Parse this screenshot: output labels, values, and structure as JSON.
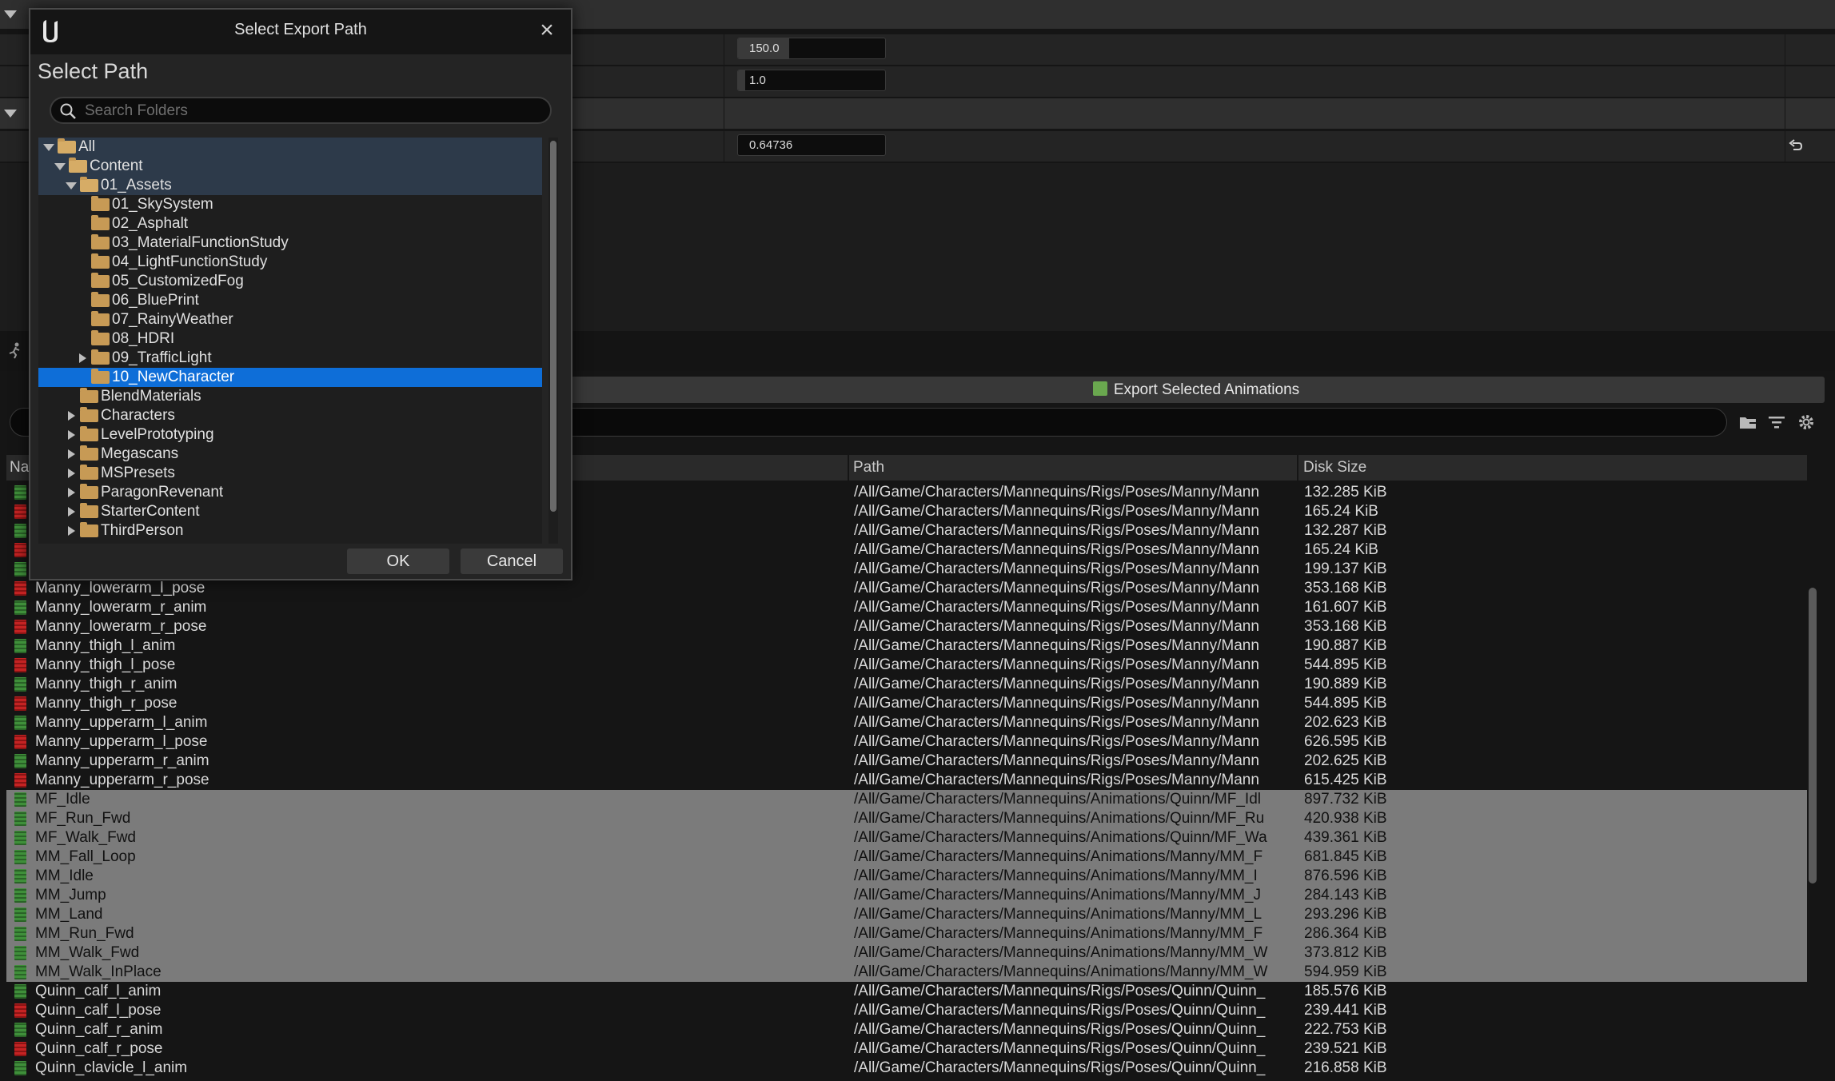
{
  "details": {
    "field_a": "150.0",
    "field_a_fill": 0.35,
    "field_b": "1.0",
    "field_b_fill": 0.05,
    "field_c": "0.64736"
  },
  "export_button": {
    "label": "Export Selected Animations"
  },
  "table": {
    "columns": {
      "name": "Na",
      "path": "Path",
      "size": "Disk Size"
    },
    "rows": [
      {
        "type": "anim",
        "name": "",
        "path": "/All/Game/Characters/Mannequins/Rigs/Poses/Manny/Mann",
        "size": "132.285 KiB",
        "selected": false
      },
      {
        "type": "pose",
        "name": "",
        "path": "/All/Game/Characters/Mannequins/Rigs/Poses/Manny/Mann",
        "size": "165.24 KiB",
        "selected": false
      },
      {
        "type": "anim",
        "name": "",
        "path": "/All/Game/Characters/Mannequins/Rigs/Poses/Manny/Mann",
        "size": "132.287 KiB",
        "selected": false
      },
      {
        "type": "pose",
        "name": "",
        "path": "/All/Game/Characters/Mannequins/Rigs/Poses/Manny/Mann",
        "size": "165.24 KiB",
        "selected": false
      },
      {
        "type": "anim",
        "name": "",
        "path": "/All/Game/Characters/Mannequins/Rigs/Poses/Manny/Mann",
        "size": "199.137 KiB",
        "selected": false
      },
      {
        "type": "pose",
        "name": "Manny_lowerarm_l_pose",
        "path": "/All/Game/Characters/Mannequins/Rigs/Poses/Manny/Mann",
        "size": "353.168 KiB",
        "selected": false
      },
      {
        "type": "anim",
        "name": "Manny_lowerarm_r_anim",
        "path": "/All/Game/Characters/Mannequins/Rigs/Poses/Manny/Mann",
        "size": "161.607 KiB",
        "selected": false
      },
      {
        "type": "pose",
        "name": "Manny_lowerarm_r_pose",
        "path": "/All/Game/Characters/Mannequins/Rigs/Poses/Manny/Mann",
        "size": "353.168 KiB",
        "selected": false
      },
      {
        "type": "anim",
        "name": "Manny_thigh_l_anim",
        "path": "/All/Game/Characters/Mannequins/Rigs/Poses/Manny/Mann",
        "size": "190.887 KiB",
        "selected": false
      },
      {
        "type": "pose",
        "name": "Manny_thigh_l_pose",
        "path": "/All/Game/Characters/Mannequins/Rigs/Poses/Manny/Mann",
        "size": "544.895 KiB",
        "selected": false
      },
      {
        "type": "anim",
        "name": "Manny_thigh_r_anim",
        "path": "/All/Game/Characters/Mannequins/Rigs/Poses/Manny/Mann",
        "size": "190.889 KiB",
        "selected": false
      },
      {
        "type": "pose",
        "name": "Manny_thigh_r_pose",
        "path": "/All/Game/Characters/Mannequins/Rigs/Poses/Manny/Mann",
        "size": "544.895 KiB",
        "selected": false
      },
      {
        "type": "anim",
        "name": "Manny_upperarm_l_anim",
        "path": "/All/Game/Characters/Mannequins/Rigs/Poses/Manny/Mann",
        "size": "202.623 KiB",
        "selected": false
      },
      {
        "type": "pose",
        "name": "Manny_upperarm_l_pose",
        "path": "/All/Game/Characters/Mannequins/Rigs/Poses/Manny/Mann",
        "size": "626.595 KiB",
        "selected": false
      },
      {
        "type": "anim",
        "name": "Manny_upperarm_r_anim",
        "path": "/All/Game/Characters/Mannequins/Rigs/Poses/Manny/Mann",
        "size": "202.625 KiB",
        "selected": false
      },
      {
        "type": "pose",
        "name": "Manny_upperarm_r_pose",
        "path": "/All/Game/Characters/Mannequins/Rigs/Poses/Manny/Mann",
        "size": "615.425 KiB",
        "selected": false
      },
      {
        "type": "anim",
        "name": "MF_Idle",
        "path": "/All/Game/Characters/Mannequins/Animations/Quinn/MF_Idl",
        "size": "897.732 KiB",
        "selected": true
      },
      {
        "type": "anim",
        "name": "MF_Run_Fwd",
        "path": "/All/Game/Characters/Mannequins/Animations/Quinn/MF_Ru",
        "size": "420.938 KiB",
        "selected": true
      },
      {
        "type": "anim",
        "name": "MF_Walk_Fwd",
        "path": "/All/Game/Characters/Mannequins/Animations/Quinn/MF_Wa",
        "size": "439.361 KiB",
        "selected": true
      },
      {
        "type": "anim",
        "name": "MM_Fall_Loop",
        "path": "/All/Game/Characters/Mannequins/Animations/Manny/MM_F",
        "size": "681.845 KiB",
        "selected": true
      },
      {
        "type": "anim",
        "name": "MM_Idle",
        "path": "/All/Game/Characters/Mannequins/Animations/Manny/MM_I",
        "size": "876.596 KiB",
        "selected": true
      },
      {
        "type": "anim",
        "name": "MM_Jump",
        "path": "/All/Game/Characters/Mannequins/Animations/Manny/MM_J",
        "size": "284.143 KiB",
        "selected": true
      },
      {
        "type": "anim",
        "name": "MM_Land",
        "path": "/All/Game/Characters/Mannequins/Animations/Manny/MM_L",
        "size": "293.296 KiB",
        "selected": true
      },
      {
        "type": "anim",
        "name": "MM_Run_Fwd",
        "path": "/All/Game/Characters/Mannequins/Animations/Manny/MM_F",
        "size": "286.364 KiB",
        "selected": true
      },
      {
        "type": "anim",
        "name": "MM_Walk_Fwd",
        "path": "/All/Game/Characters/Mannequins/Animations/Manny/MM_W",
        "size": "373.812 KiB",
        "selected": true
      },
      {
        "type": "anim",
        "name": "MM_Walk_InPlace",
        "path": "/All/Game/Characters/Mannequins/Animations/Manny/MM_W",
        "size": "594.959 KiB",
        "selected": true
      },
      {
        "type": "anim",
        "name": "Quinn_calf_l_anim",
        "path": "/All/Game/Characters/Mannequins/Rigs/Poses/Quinn/Quinn_",
        "size": "185.576 KiB",
        "selected": false
      },
      {
        "type": "pose",
        "name": "Quinn_calf_l_pose",
        "path": "/All/Game/Characters/Mannequins/Rigs/Poses/Quinn/Quinn_",
        "size": "239.441 KiB",
        "selected": false
      },
      {
        "type": "anim",
        "name": "Quinn_calf_r_anim",
        "path": "/All/Game/Characters/Mannequins/Rigs/Poses/Quinn/Quinn_",
        "size": "222.753 KiB",
        "selected": false
      },
      {
        "type": "pose",
        "name": "Quinn_calf_r_pose",
        "path": "/All/Game/Characters/Mannequins/Rigs/Poses/Quinn/Quinn_",
        "size": "239.521 KiB",
        "selected": false
      },
      {
        "type": "anim",
        "name": "Quinn_clavicle_l_anim",
        "path": "/All/Game/Characters/Mannequins/Rigs/Poses/Quinn/Quinn_",
        "size": "216.858 KiB",
        "selected": false
      }
    ]
  },
  "dialog": {
    "title": "Select Export Path",
    "heading": "Select Path",
    "search_placeholder": "Search Folders",
    "ok_label": "OK",
    "cancel_label": "Cancel",
    "tree": [
      {
        "label": "All",
        "depth": 0,
        "expander": "down",
        "folder_open": true,
        "highlight": true,
        "current": false
      },
      {
        "label": "Content",
        "depth": 1,
        "expander": "down",
        "folder_open": true,
        "highlight": true,
        "current": false
      },
      {
        "label": "01_Assets",
        "depth": 2,
        "expander": "down",
        "folder_open": true,
        "highlight": true,
        "current": false
      },
      {
        "label": "01_SkySystem",
        "depth": 3,
        "expander": "none",
        "folder_open": false,
        "highlight": false,
        "current": false
      },
      {
        "label": "02_Asphalt",
        "depth": 3,
        "expander": "none",
        "folder_open": false,
        "highlight": false,
        "current": false
      },
      {
        "label": "03_MaterialFunctionStudy",
        "depth": 3,
        "expander": "none",
        "folder_open": false,
        "highlight": false,
        "current": false
      },
      {
        "label": "04_LightFunctionStudy",
        "depth": 3,
        "expander": "none",
        "folder_open": false,
        "highlight": false,
        "current": false
      },
      {
        "label": "05_CustomizedFog",
        "depth": 3,
        "expander": "none",
        "folder_open": false,
        "highlight": false,
        "current": false
      },
      {
        "label": "06_BluePrint",
        "depth": 3,
        "expander": "none",
        "folder_open": false,
        "highlight": false,
        "current": false
      },
      {
        "label": "07_RainyWeather",
        "depth": 3,
        "expander": "none",
        "folder_open": false,
        "highlight": false,
        "current": false
      },
      {
        "label": "08_HDRI",
        "depth": 3,
        "expander": "none",
        "folder_open": false,
        "highlight": false,
        "current": false
      },
      {
        "label": "09_TrafficLight",
        "depth": 3,
        "expander": "right",
        "folder_open": false,
        "highlight": false,
        "current": false
      },
      {
        "label": "10_NewCharacter",
        "depth": 3,
        "expander": "none",
        "folder_open": false,
        "highlight": false,
        "current": true
      },
      {
        "label": "BlendMaterials",
        "depth": 2,
        "expander": "none",
        "folder_open": false,
        "highlight": false,
        "current": false
      },
      {
        "label": "Characters",
        "depth": 2,
        "expander": "right",
        "folder_open": false,
        "highlight": false,
        "current": false
      },
      {
        "label": "LevelPrototyping",
        "depth": 2,
        "expander": "right",
        "folder_open": false,
        "highlight": false,
        "current": false
      },
      {
        "label": "Megascans",
        "depth": 2,
        "expander": "right",
        "folder_open": false,
        "highlight": false,
        "current": false
      },
      {
        "label": "MSPresets",
        "depth": 2,
        "expander": "right",
        "folder_open": false,
        "highlight": false,
        "current": false
      },
      {
        "label": "ParagonRevenant",
        "depth": 2,
        "expander": "right",
        "folder_open": false,
        "highlight": false,
        "current": false
      },
      {
        "label": "StarterContent",
        "depth": 2,
        "expander": "right",
        "folder_open": false,
        "highlight": false,
        "current": false
      },
      {
        "label": "ThirdPerson",
        "depth": 2,
        "expander": "right",
        "folder_open": false,
        "highlight": false,
        "current": false
      }
    ]
  },
  "colors": {
    "selection_blue": "#0e6ed8",
    "folder": "#c79a55",
    "anim_icon": "#3f8f3a",
    "pose_icon": "#c42323",
    "selected_row": "#7b7b7b"
  }
}
